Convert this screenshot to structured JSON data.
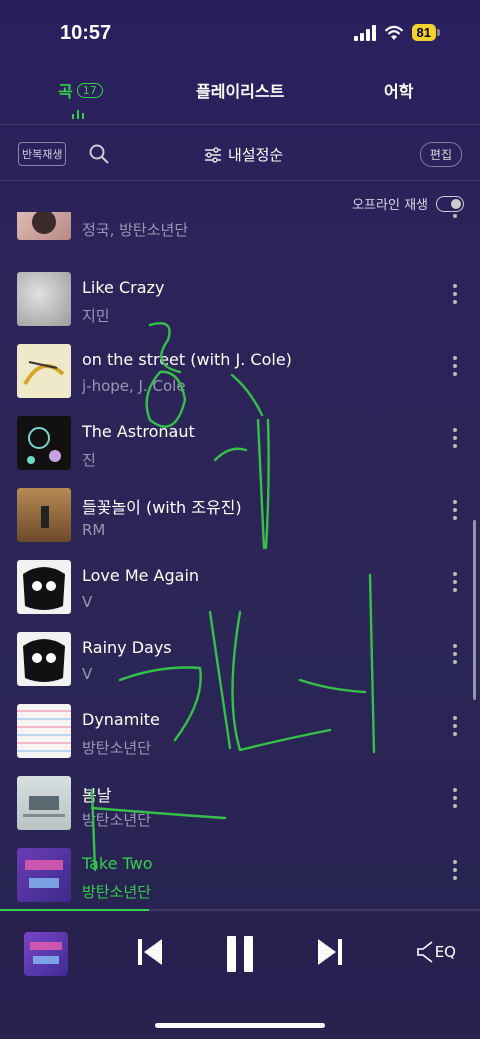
{
  "status": {
    "time": "10:57",
    "battery": "81"
  },
  "tabs": {
    "songs": "곡",
    "songs_count": "17",
    "playlist": "플레이리스트",
    "vocab": "어학"
  },
  "toolbar": {
    "repeat": "반복재생",
    "sort": "내설정순",
    "edit": "편집"
  },
  "offline": {
    "label": "오프라인 재생"
  },
  "songs": [
    {
      "title": "",
      "artist": "정국, 방탄소년단"
    },
    {
      "title": "Like Crazy",
      "artist": "지민"
    },
    {
      "title": "on the street (with J. Cole)",
      "artist": "j-hope, J. Cole"
    },
    {
      "title": "The Astronaut",
      "artist": "진"
    },
    {
      "title": "들꽃놀이 (with 조유진)",
      "artist": "RM"
    },
    {
      "title": "Love Me Again",
      "artist": "V"
    },
    {
      "title": "Rainy Days",
      "artist": "V"
    },
    {
      "title": "Dynamite",
      "artist": "방탄소년단"
    },
    {
      "title": "봄날",
      "artist": "방탄소년단"
    },
    {
      "title": "Take Two",
      "artist": "방탄소년단"
    }
  ],
  "player": {
    "eq": "EQ",
    "progress": 0.31
  },
  "colors": {
    "accent": "#35d049",
    "background": "#2a2358"
  }
}
